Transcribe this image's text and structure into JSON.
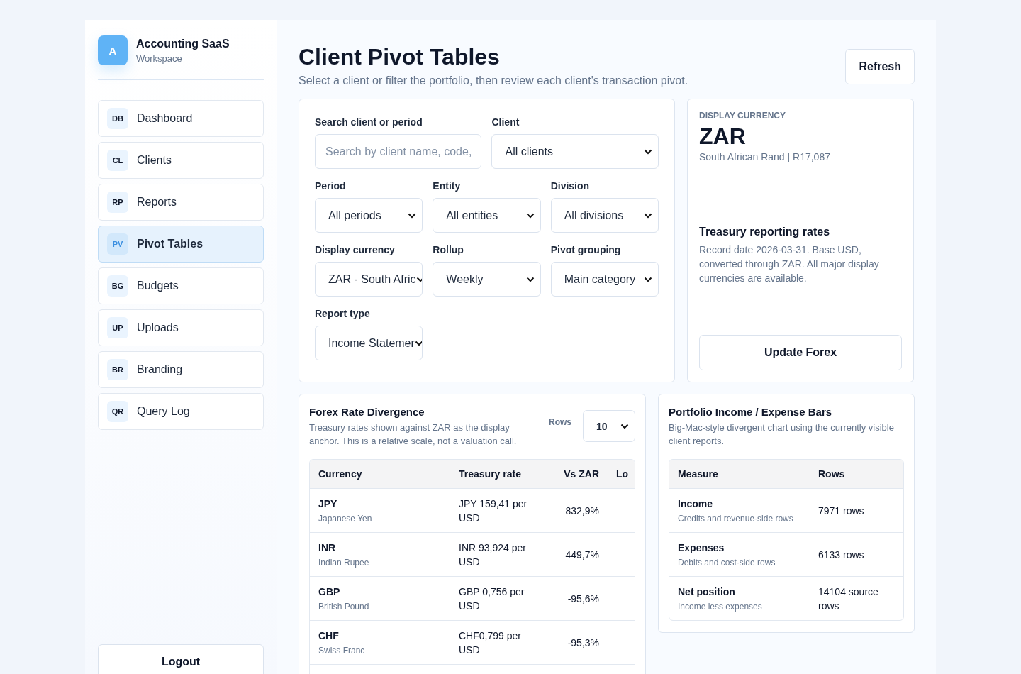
{
  "brand": {
    "logo": "A",
    "name": "Accounting SaaS",
    "subtitle": "Workspace"
  },
  "nav": [
    {
      "code": "DB",
      "label": "Dashboard",
      "selected": false
    },
    {
      "code": "CL",
      "label": "Clients",
      "selected": false
    },
    {
      "code": "RP",
      "label": "Reports",
      "selected": false
    },
    {
      "code": "PV",
      "label": "Pivot Tables",
      "selected": true
    },
    {
      "code": "BG",
      "label": "Budgets",
      "selected": false
    },
    {
      "code": "UP",
      "label": "Uploads",
      "selected": false
    },
    {
      "code": "BR",
      "label": "Branding",
      "selected": false
    },
    {
      "code": "QR",
      "label": "Query Log",
      "selected": false
    }
  ],
  "logout": "Logout",
  "header": {
    "title": "Client Pivot Tables",
    "subtitle": "Select a client or filter the portfolio, then review each client's transaction pivot.",
    "refresh": "Refresh"
  },
  "filters": [
    {
      "kind": "search",
      "label": "Search client or period",
      "placeholder": "Search by client name, code,"
    },
    {
      "kind": "select",
      "label": "Client",
      "value": "All clients"
    },
    {
      "kind": "select",
      "label": "Period",
      "value": "All periods"
    },
    {
      "kind": "select",
      "label": "Entity",
      "value": "All entities"
    },
    {
      "kind": "select",
      "label": "Division",
      "value": "All divisions"
    },
    {
      "kind": "select",
      "label": "Display currency",
      "value": "ZAR - South Afric"
    },
    {
      "kind": "select",
      "label": "Rollup",
      "value": "Weekly"
    },
    {
      "kind": "select",
      "label": "Pivot grouping",
      "value": "Main category"
    },
    {
      "kind": "select",
      "label": "Report type",
      "value": "Income Statemer"
    }
  ],
  "currency_card": {
    "eyebrow": "DISPLAY CURRENCY",
    "code": "ZAR",
    "detail": "South African Rand | R17,087",
    "rates_title": "Treasury reporting rates",
    "rates_text": "Record date 2026-03-31. Base USD, converted through ZAR. All major display currencies are available.",
    "button": "Update Forex"
  },
  "forex": {
    "title": "Forex Rate Divergence",
    "description": "Treasury rates shown against ZAR as the display anchor. This is a relative scale, not a valuation call.",
    "rows_label": "Rows",
    "rows_value": "10",
    "columns": [
      "Currency",
      "Treasury rate",
      "Vs ZAR",
      "Lo"
    ],
    "rows": [
      {
        "code": "JPY",
        "name": "Japanese Yen",
        "rate": "JPY 159,41 per USD",
        "vs": "832,9%"
      },
      {
        "code": "INR",
        "name": "Indian Rupee",
        "rate": "INR 93,924 per USD",
        "vs": "449,7%"
      },
      {
        "code": "GBP",
        "name": "British Pound",
        "rate": "GBP 0,756 per USD",
        "vs": "-95,6%"
      },
      {
        "code": "CHF",
        "name": "Swiss Franc",
        "rate": "CHF0,799 per USD",
        "vs": "-95,3%"
      }
    ]
  },
  "portfolio": {
    "title": "Portfolio Income / Expense Bars",
    "description": "Big-Mac-style divergent chart using the currently visible client reports.",
    "columns": [
      "Measure",
      "Rows"
    ],
    "rows": [
      {
        "measure": "Income",
        "note": "Credits and revenue-side rows",
        "rows": "7971 rows"
      },
      {
        "measure": "Expenses",
        "note": "Debits and cost-side rows",
        "rows": "6133 rows"
      },
      {
        "measure": "Net position",
        "note": "Income less expenses",
        "rows": "14104 source rows"
      }
    ]
  }
}
